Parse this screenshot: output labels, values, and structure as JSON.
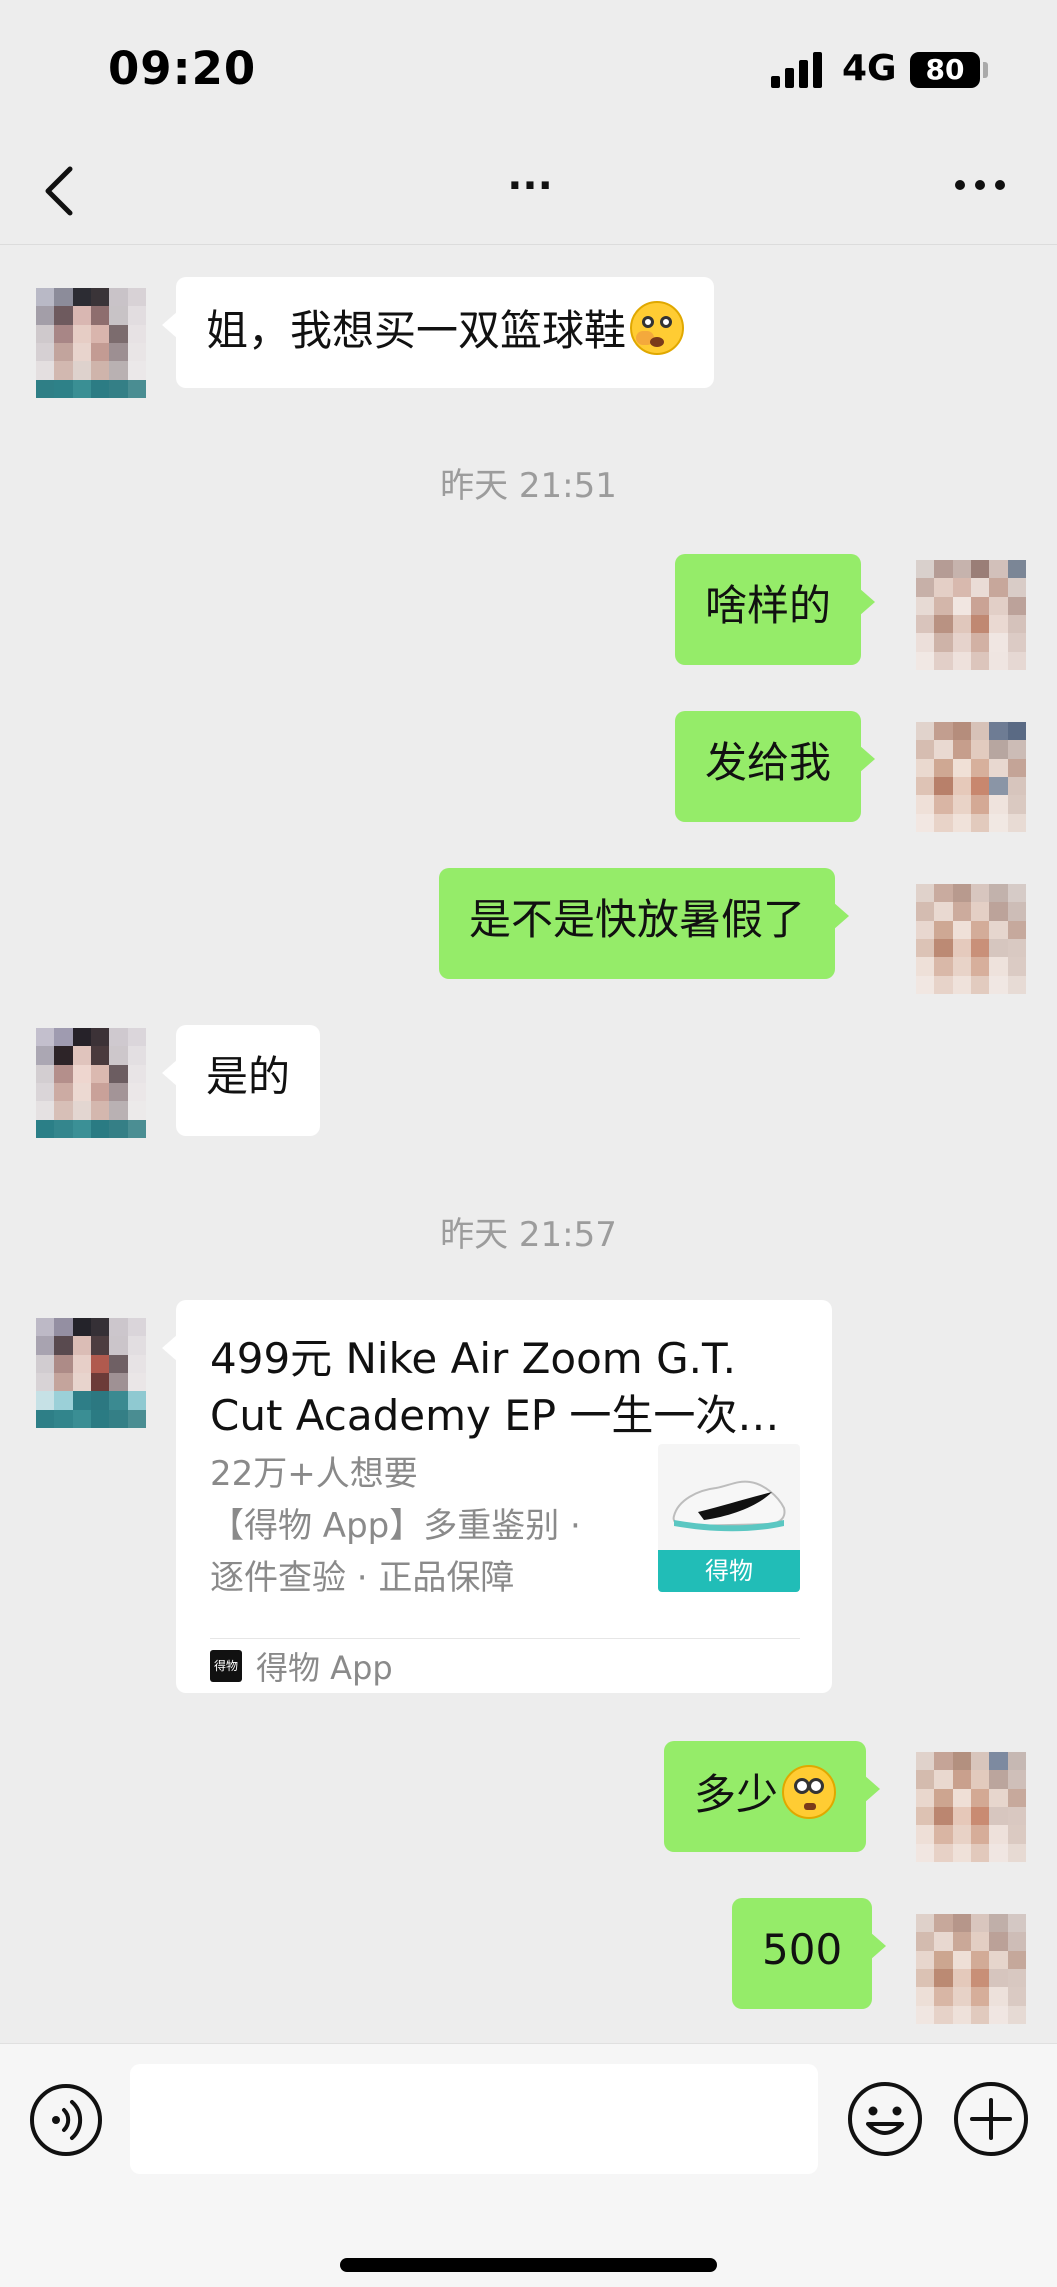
{
  "status_bar": {
    "time": "09:20",
    "network": "4G",
    "battery": "80"
  },
  "nav": {
    "title": "..."
  },
  "messages": [
    {
      "side": "in",
      "text": "姐，我想买一双篮球鞋"
    },
    {
      "side": "timestamp",
      "text": "昨天 21:51"
    },
    {
      "side": "out",
      "text": "啥样的"
    },
    {
      "side": "out",
      "text": "发给我"
    },
    {
      "side": "out",
      "text": "是不是快放暑假了"
    },
    {
      "side": "in",
      "text": "是的"
    },
    {
      "side": "timestamp",
      "text": "昨天 21:57"
    },
    {
      "side": "out",
      "text": "多少"
    },
    {
      "side": "out",
      "text": "500"
    }
  ],
  "link_card": {
    "title_line1": "499元 Nike Air Zoom G.T.",
    "title_line2": "Cut Academy EP 一生一次…",
    "desc_line1": "22万+人想要",
    "desc_line2": "【得物 App】多重鉴别 ·",
    "desc_line3": "逐件查验 · 正品保障",
    "thumb_label": "得物",
    "app_logo": "得物",
    "source": "得物 App"
  },
  "icons": {
    "back": "chevron-left-icon",
    "more": "more-horizontal-icon",
    "voice": "voice-icon",
    "emoji": "emoji-icon",
    "plus": "plus-icon"
  },
  "colors": {
    "outgoing_bubble": "#95ec69",
    "incoming_bubble": "#ffffff",
    "background": "#ededed",
    "thumb_accent": "#21bdb7"
  }
}
